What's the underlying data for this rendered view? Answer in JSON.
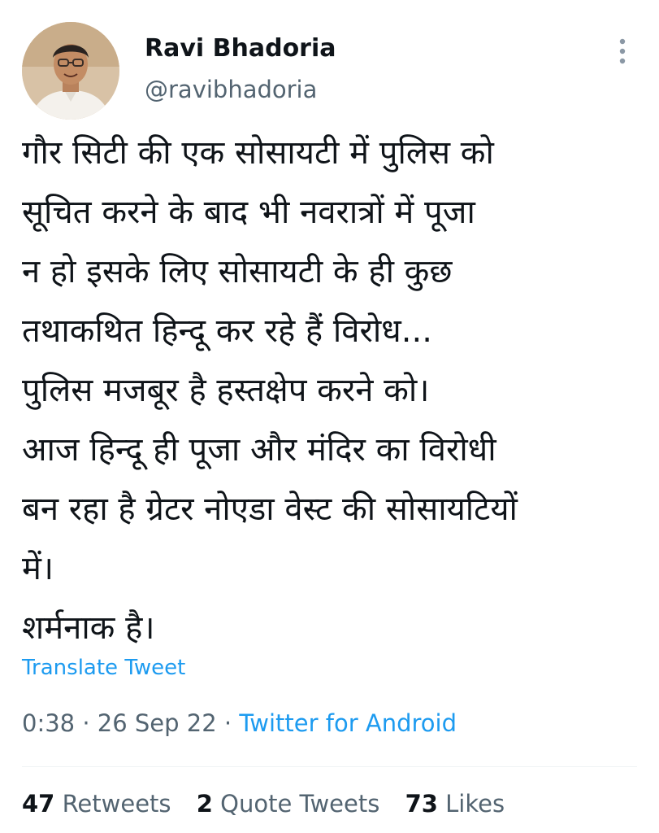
{
  "author": {
    "display_name": "Ravi Bhadoria",
    "handle": "@ravibhadoria"
  },
  "tweet": {
    "lines": [
      "गौर सिटी की एक सोसायटी में पुलिस को",
      "सूचित करने के बाद भी नवरात्रों में पूजा",
      "न हो इसके लिए सोसायटी के ही कुछ",
      "तथाकथित हिन्दू कर रहे हैं विरोध...",
      "पुलिस मजबूर है हस्तक्षेप करने को।",
      "आज हिन्दू ही पूजा और मंदिर का विरोधी",
      "बन रहा है ग्रेटर नोएडा वेस्ट की सोसायटियों",
      "में।",
      "शर्मनाक है।"
    ],
    "translate_label": "Translate Tweet"
  },
  "meta": {
    "time": "0:38",
    "separator": " · ",
    "date": "26 Sep 22",
    "source": "Twitter for Android"
  },
  "stats": {
    "retweets_count": "47",
    "retweets_label": "Retweets",
    "quotes_count": "2",
    "quotes_label": "Quote Tweets",
    "likes_count": "73",
    "likes_label": "Likes"
  },
  "icons": {
    "more": "more-vertical-icon",
    "avatar": "profile-photo"
  },
  "colors": {
    "link": "#1d9bf0",
    "secondary": "#536471",
    "primary": "#0f1419"
  }
}
